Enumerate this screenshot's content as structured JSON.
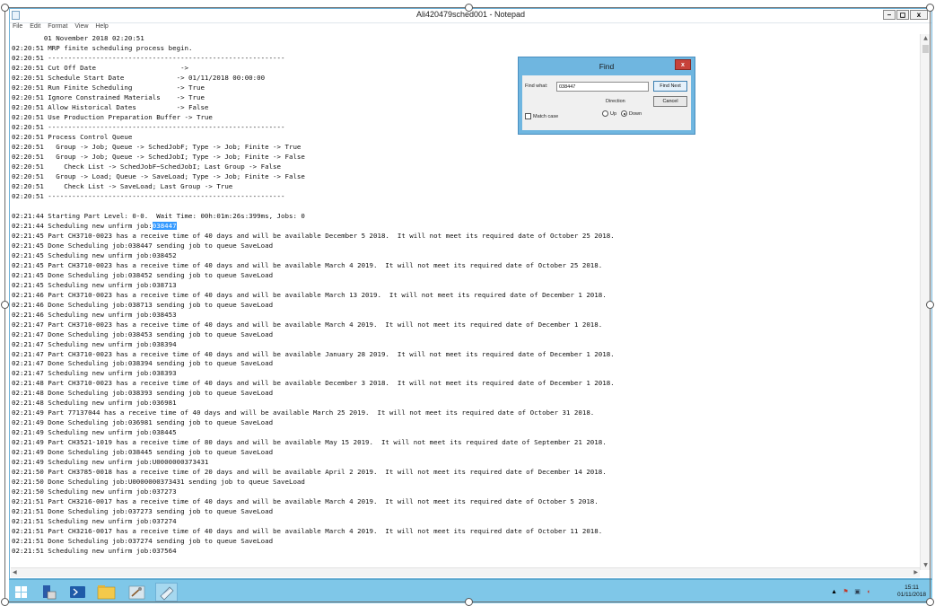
{
  "window": {
    "title": "Ali420479sched001 - Notepad",
    "controls": {
      "minimize": "–",
      "maximize": "◻",
      "close": "x"
    }
  },
  "menu": [
    "File",
    "Edit",
    "Format",
    "View",
    "Help"
  ],
  "document": {
    "lines": [
      "        01 November 2018 02:20:51",
      "02:20:51 MRP finite scheduling process begin.",
      "02:20:51 -----------------------------------------------------------",
      "02:20:51 Cut Off Date                     ->",
      "02:20:51 Schedule Start Date             -> 01/11/2018 00:00:00",
      "02:20:51 Run Finite Scheduling           -> True",
      "02:20:51 Ignore Constrained Materials    -> True",
      "02:20:51 Allow Historical Dates          -> False",
      "02:20:51 Use Production Preparation Buffer -> True",
      "02:20:51 -----------------------------------------------------------",
      "02:20:51 Process Control Queue",
      "02:20:51   Group -> Job; Queue -> SchedJobF; Type -> Job; Finite -> True",
      "02:20:51   Group -> Job; Queue -> SchedJobI; Type -> Job; Finite -> False",
      "02:20:51     Check List -> SchedJobF~SchedJobI; Last Group -> False",
      "02:20:51   Group -> Load; Queue -> SaveLoad; Type -> Job; Finite -> False",
      "02:20:51     Check List -> SaveLoad; Last Group -> True",
      "02:20:51 -----------------------------------------------------------",
      "",
      "02:21:44 Starting Part Level: 0-0.  Wait Time: 00h:01m:26s:399ms, Jobs: 0",
      "02:21:44 Scheduling new unfirm job:038447",
      "02:21:45 Part CH3710-0023 has a receive time of 40 days and will be available December 5 2018.  It will not meet its required date of October 25 2018.",
      "02:21:45 Done Scheduling job:038447 sending job to queue SaveLoad",
      "02:21:45 Scheduling new unfirm job:038452",
      "02:21:45 Part CH3710-0023 has a receive time of 40 days and will be available March 4 2019.  It will not meet its required date of October 25 2018.",
      "02:21:45 Done Scheduling job:038452 sending job to queue SaveLoad",
      "02:21:45 Scheduling new unfirm job:038713",
      "02:21:46 Part CH3710-0023 has a receive time of 40 days and will be available March 13 2019.  It will not meet its required date of December 1 2018.",
      "02:21:46 Done Scheduling job:038713 sending job to queue SaveLoad",
      "02:21:46 Scheduling new unfirm job:038453",
      "02:21:47 Part CH3710-0023 has a receive time of 40 days and will be available March 4 2019.  It will not meet its required date of December 1 2018.",
      "02:21:47 Done Scheduling job:038453 sending job to queue SaveLoad",
      "02:21:47 Scheduling new unfirm job:038394",
      "02:21:47 Part CH3710-0023 has a receive time of 40 days and will be available January 28 2019.  It will not meet its required date of December 1 2018.",
      "02:21:47 Done Scheduling job:038394 sending job to queue SaveLoad",
      "02:21:47 Scheduling new unfirm job:038393",
      "02:21:48 Part CH3710-0023 has a receive time of 40 days and will be available December 3 2018.  It will not meet its required date of December 1 2018.",
      "02:21:48 Done Scheduling job:038393 sending job to queue SaveLoad",
      "02:21:48 Scheduling new unfirm job:036981",
      "02:21:49 Part 77137044 has a receive time of 40 days and will be available March 25 2019.  It will not meet its required date of October 31 2018.",
      "02:21:49 Done Scheduling job:036981 sending job to queue SaveLoad",
      "02:21:49 Scheduling new unfirm job:038445",
      "02:21:49 Part CH3521-1019 has a receive time of 80 days and will be available May 15 2019.  It will not meet its required date of September 21 2018.",
      "02:21:49 Done Scheduling job:038445 sending job to queue SaveLoad",
      "02:21:49 Scheduling new unfirm job:U0000000373431",
      "02:21:50 Part CH3785-0018 has a receive time of 20 days and will be available April 2 2019.  It will not meet its required date of December 14 2018.",
      "02:21:50 Done Scheduling job:U0000000373431 sending job to queue SaveLoad",
      "02:21:50 Scheduling new unfirm job:037273",
      "02:21:51 Part CH3216-0017 has a receive time of 40 days and will be available March 4 2019.  It will not meet its required date of October 5 2018.",
      "02:21:51 Done Scheduling job:037273 sending job to queue SaveLoad",
      "02:21:51 Scheduling new unfirm job:037274",
      "02:21:51 Part CH3216-0017 has a receive time of 40 days and will be available March 4 2019.  It will not meet its required date of October 11 2018.",
      "02:21:51 Done Scheduling job:037274 sending job to queue SaveLoad",
      "02:21:51 Scheduling new unfirm job:037564"
    ],
    "selected_text": "038447",
    "selected_line_prefix": "02:21:44 Scheduling new unfirm job:",
    "selected_line_index": 19
  },
  "find_dialog": {
    "title": "Find",
    "close": "x",
    "find_what_label": "Find what:",
    "find_what_value": "038447",
    "find_next": "Find Next",
    "cancel": "Cancel",
    "direction_label": "Direction",
    "up_label": "Up",
    "down_label": "Down",
    "direction": "down",
    "match_case_label": "Match case",
    "match_case": false
  },
  "taskbar": {
    "items": [
      "start-icon",
      "server-manager-icon",
      "powershell-icon",
      "file-explorer-icon",
      "tools-icon",
      "notepad-icon"
    ],
    "clock_time": "15:11",
    "clock_date": "01/11/2018"
  }
}
